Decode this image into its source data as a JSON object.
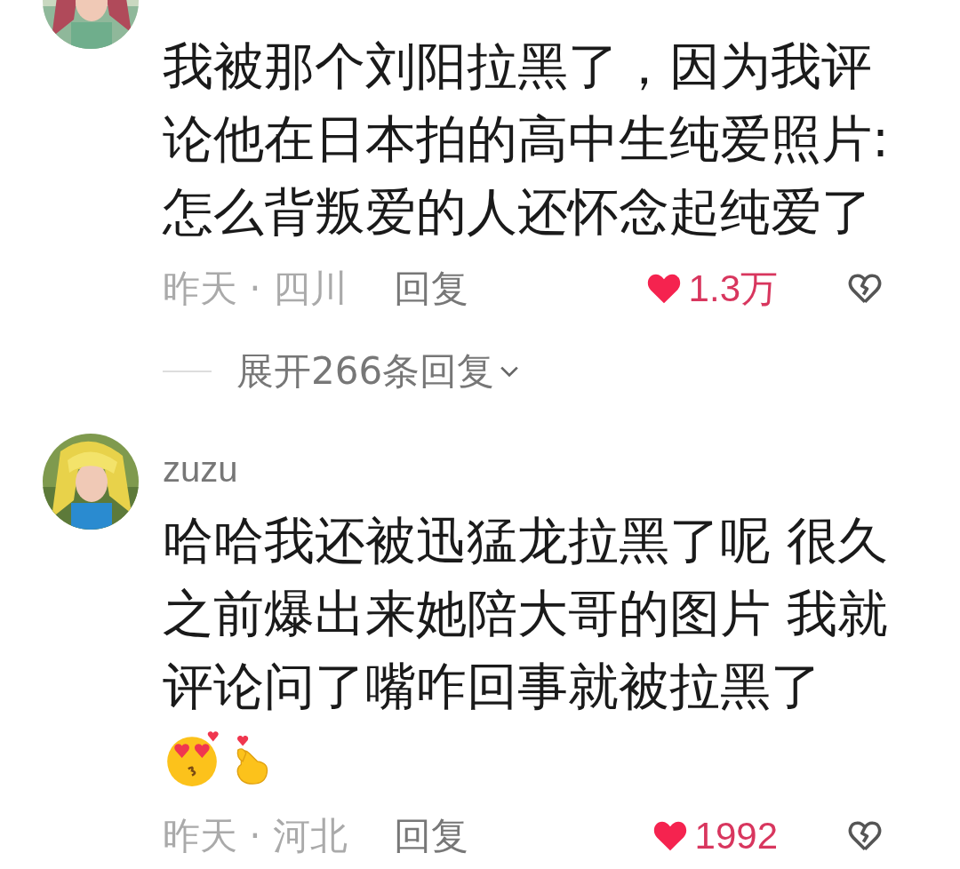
{
  "comments": [
    {
      "text": "我被那个刘阳拉黑了，因为我评论他在日本拍的高中生纯爱照片: 怎么背叛爱的人还怀念起纯爱了",
      "time": "昨天 · 四川",
      "reply": "回复",
      "likes": "1.3万",
      "expand": "展开266条回复"
    },
    {
      "username": "zuzu",
      "text": "哈哈我还被迅猛龙拉黑了呢 很久之前爆出来她陪大哥的图片 我就评论问了嘴咋回事就被拉黑了",
      "emojis": [
        {
          "kind": "heart-eyes"
        },
        {
          "kind": "finger-heart"
        }
      ],
      "time": "昨天 · 河北",
      "reply": "回复",
      "likes": "1992"
    }
  ]
}
